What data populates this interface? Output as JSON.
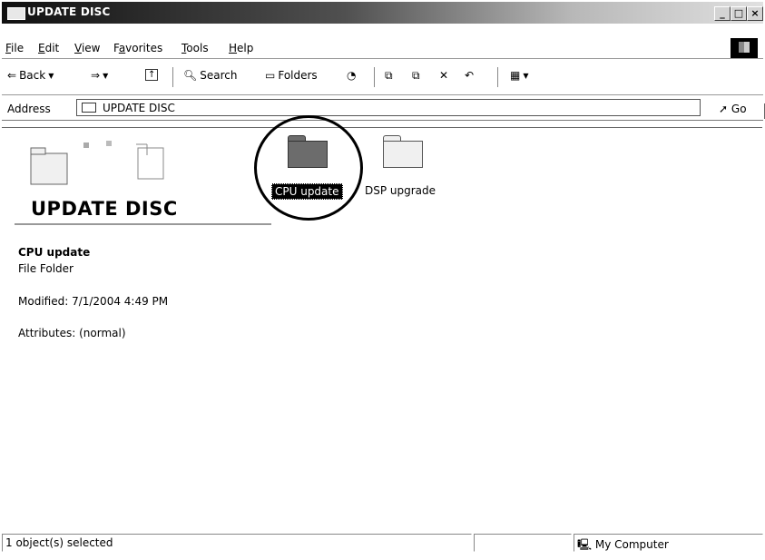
{
  "window": {
    "title": "UPDATE DISC",
    "controls": {
      "minimize": "_",
      "maximize": "□",
      "close": "×"
    }
  },
  "menu": {
    "items": [
      "File",
      "Edit",
      "View",
      "Favorites",
      "Tools",
      "Help"
    ],
    "mnemonics": [
      "F",
      "E",
      "V",
      "a",
      "T",
      "H"
    ]
  },
  "toolbar": {
    "back_label": "Back",
    "search_label": "Search",
    "folders_label": "Folders",
    "icons": [
      "back-arrow-icon",
      "forward-arrow-icon",
      "up-folder-icon",
      "search-icon",
      "folders-icon",
      "history-icon",
      "move-to-icon",
      "copy-to-icon",
      "delete-icon",
      "undo-icon",
      "views-icon"
    ]
  },
  "address": {
    "label": "Address",
    "value": "UPDATE DISC",
    "go_label": "Go"
  },
  "content": {
    "heading": "UPDATE DISC",
    "selected": {
      "name": "CPU update",
      "type": "File Folder",
      "modified": "Modified: 7/1/2004 4:49 PM",
      "attributes": "Attributes: (normal)"
    },
    "items": [
      {
        "name": "CPU update",
        "selected": true
      },
      {
        "name": "DSP upgrade",
        "selected": false
      }
    ]
  },
  "status": {
    "left": "1 object(s) selected",
    "zone": "My Computer"
  },
  "colors": {
    "selection": "#000000",
    "selected_folder": "#6c6c6c"
  }
}
